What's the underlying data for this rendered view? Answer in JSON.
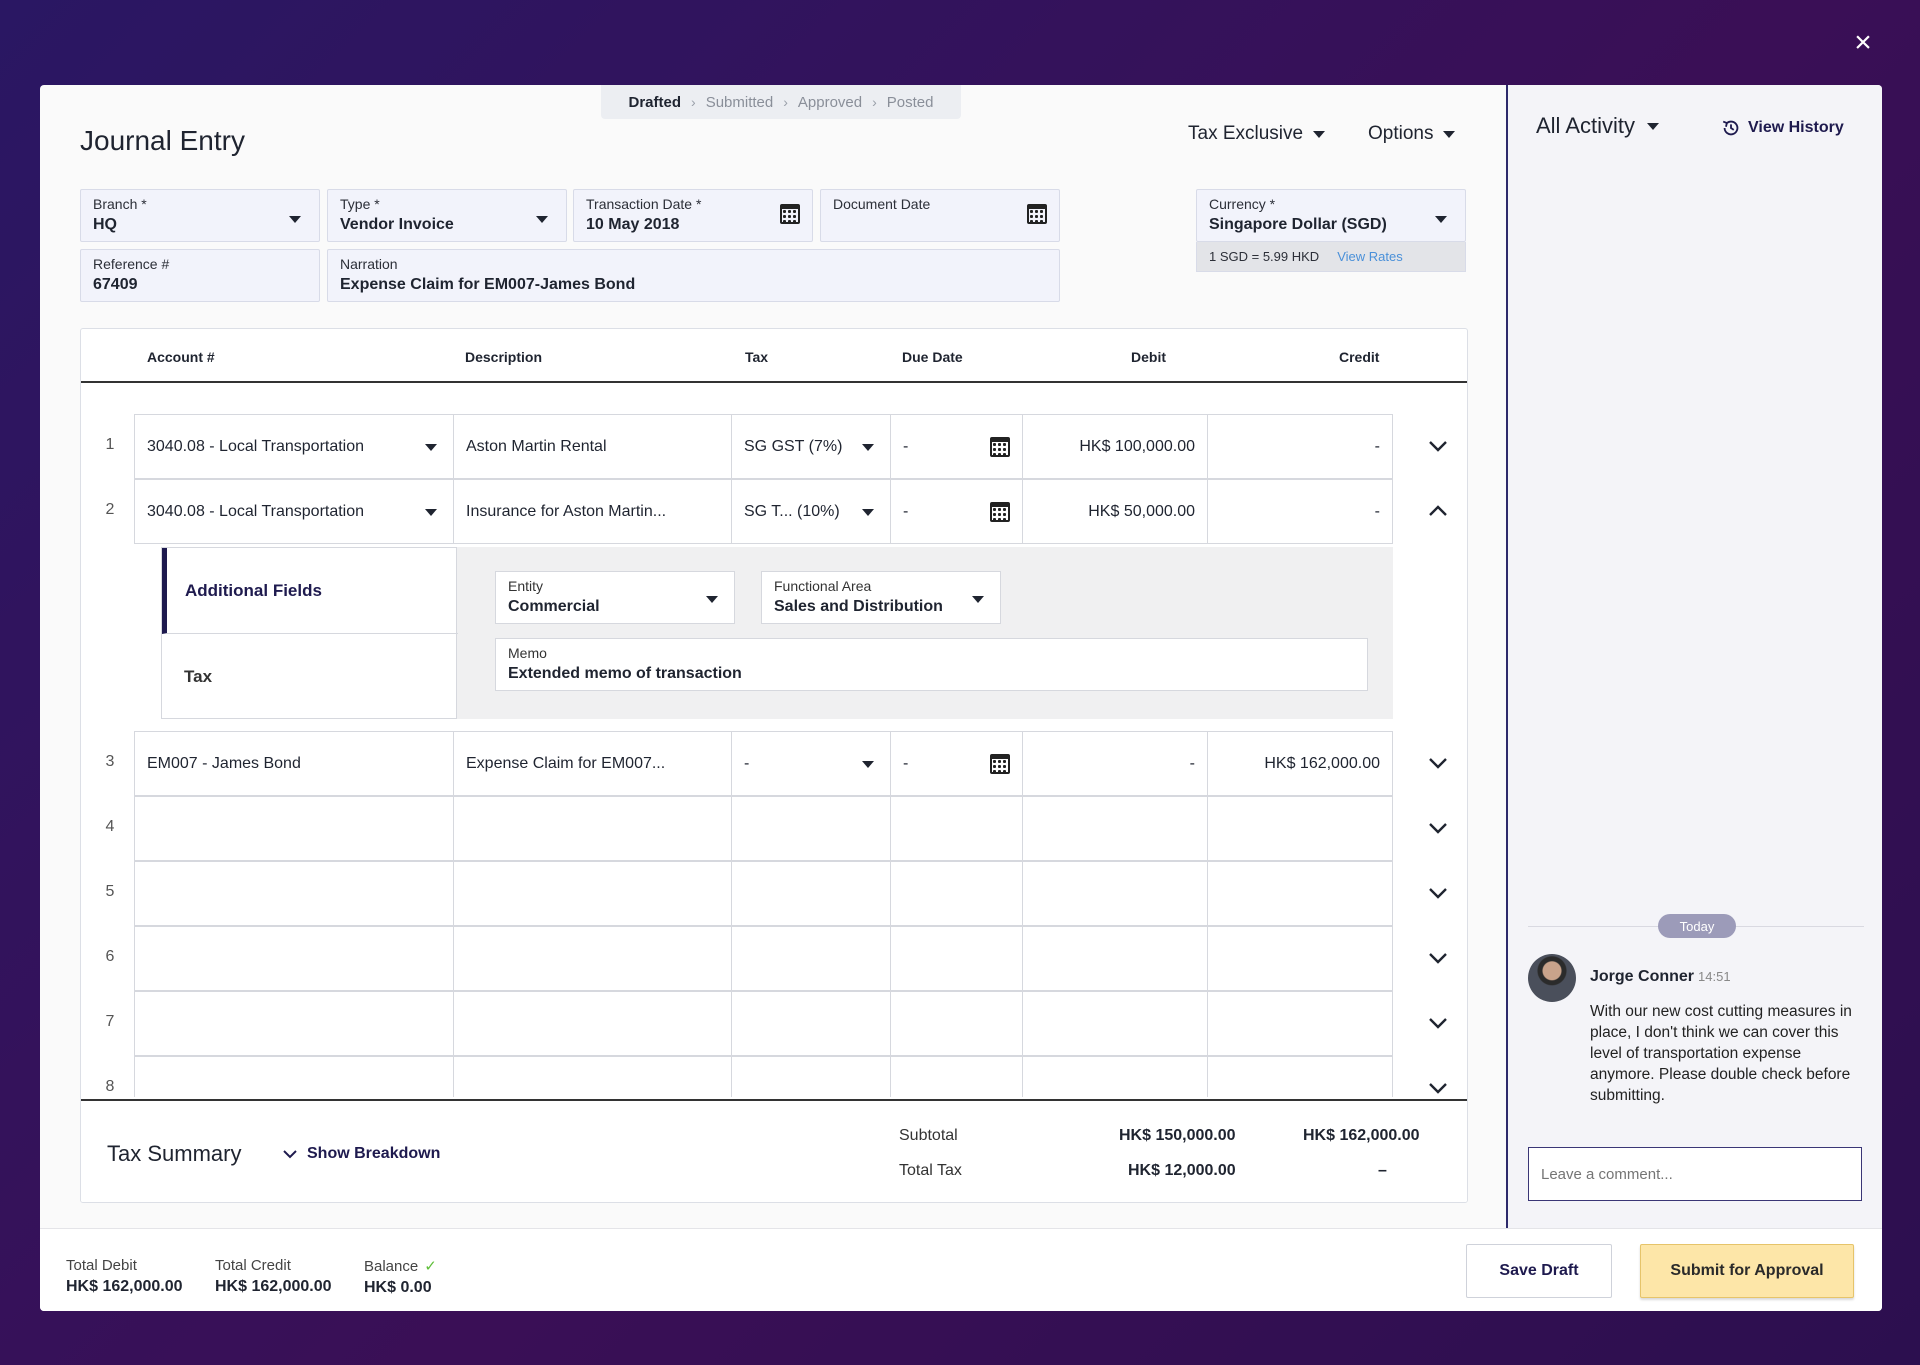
{
  "close_label": "×",
  "stepper": [
    "Drafted",
    "Submitted",
    "Approved",
    "Posted"
  ],
  "title": "Journal Entry",
  "tax_mode": "Tax Exclusive",
  "options": "Options",
  "fields": {
    "branch": {
      "label": "Branch *",
      "value": "HQ"
    },
    "type": {
      "label": "Type *",
      "value": "Vendor Invoice"
    },
    "transaction_date": {
      "label": "Transaction Date *",
      "value": "10 May 2018"
    },
    "document_date": {
      "label": "Document Date",
      "value": ""
    },
    "reference": {
      "label": "Reference #",
      "value": "67409"
    },
    "narration": {
      "label": "Narration",
      "value": "Expense Claim for EM007-James Bond"
    },
    "currency": {
      "label": "Currency *",
      "value": "Singapore Dollar (SGD)"
    }
  },
  "rate": {
    "text": "1 SGD = 5.99 HKD",
    "link": "View Rates"
  },
  "columns": [
    "Account #",
    "Description",
    "Tax",
    "Due Date",
    "Debit",
    "Credit"
  ],
  "rows": [
    {
      "num": "1",
      "account": "3040.08 - Local Transportation",
      "description": "Aston Martin Rental",
      "tax": "SG GST (7%)",
      "due": "-",
      "debit": "HK$ 100,000.00",
      "credit": "-"
    },
    {
      "num": "2",
      "account": "3040.08 - Local Transportation",
      "description": "Insurance for Aston Martin...",
      "tax": "SG T... (10%)",
      "due": "-",
      "debit": "HK$ 50,000.00",
      "credit": "-"
    },
    {
      "num": "3",
      "account": "EM007 - James Bond",
      "description": "Expense Claim for EM007...",
      "tax": "-",
      "due": "-",
      "debit": "-",
      "credit": "HK$ 162,000.00"
    },
    {
      "num": "4"
    },
    {
      "num": "5"
    },
    {
      "num": "6"
    },
    {
      "num": "7"
    },
    {
      "num": "8"
    }
  ],
  "expanded": {
    "tab_additional": "Additional Fields",
    "tab_tax": "Tax",
    "entity": {
      "label": "Entity",
      "value": "Commercial"
    },
    "functional_area": {
      "label": "Functional Area",
      "value": "Sales and Distribution"
    },
    "memo": {
      "label": "Memo",
      "value": "Extended memo of transaction"
    }
  },
  "summary": {
    "title": "Tax Summary",
    "breakdown": "Show Breakdown",
    "subtotal_label": "Subtotal",
    "subtotal_debit": "HK$ 150,000.00",
    "subtotal_credit": "HK$ 162,000.00",
    "total_tax_label": "Total Tax",
    "total_tax_debit": "HK$ 12,000.00",
    "total_tax_credit": "–"
  },
  "footer": {
    "total_debit_label": "Total Debit",
    "total_debit": "HK$ 162,000.00",
    "total_credit_label": "Total Credit",
    "total_credit": "HK$ 162,000.00",
    "balance_label": "Balance",
    "balance": "HK$ 0.00",
    "save": "Save Draft",
    "submit": "Submit for Approval"
  },
  "sidebar": {
    "activity": "All Activity",
    "history": "View History",
    "today": "Today",
    "comment": {
      "name": "Jorge Conner",
      "time": "14:51",
      "body": "With our new cost cutting measures in place, I don't think we can cover this level of transportation expense anymore. Please double check before submitting."
    },
    "comment_placeholder": "Leave a comment..."
  }
}
